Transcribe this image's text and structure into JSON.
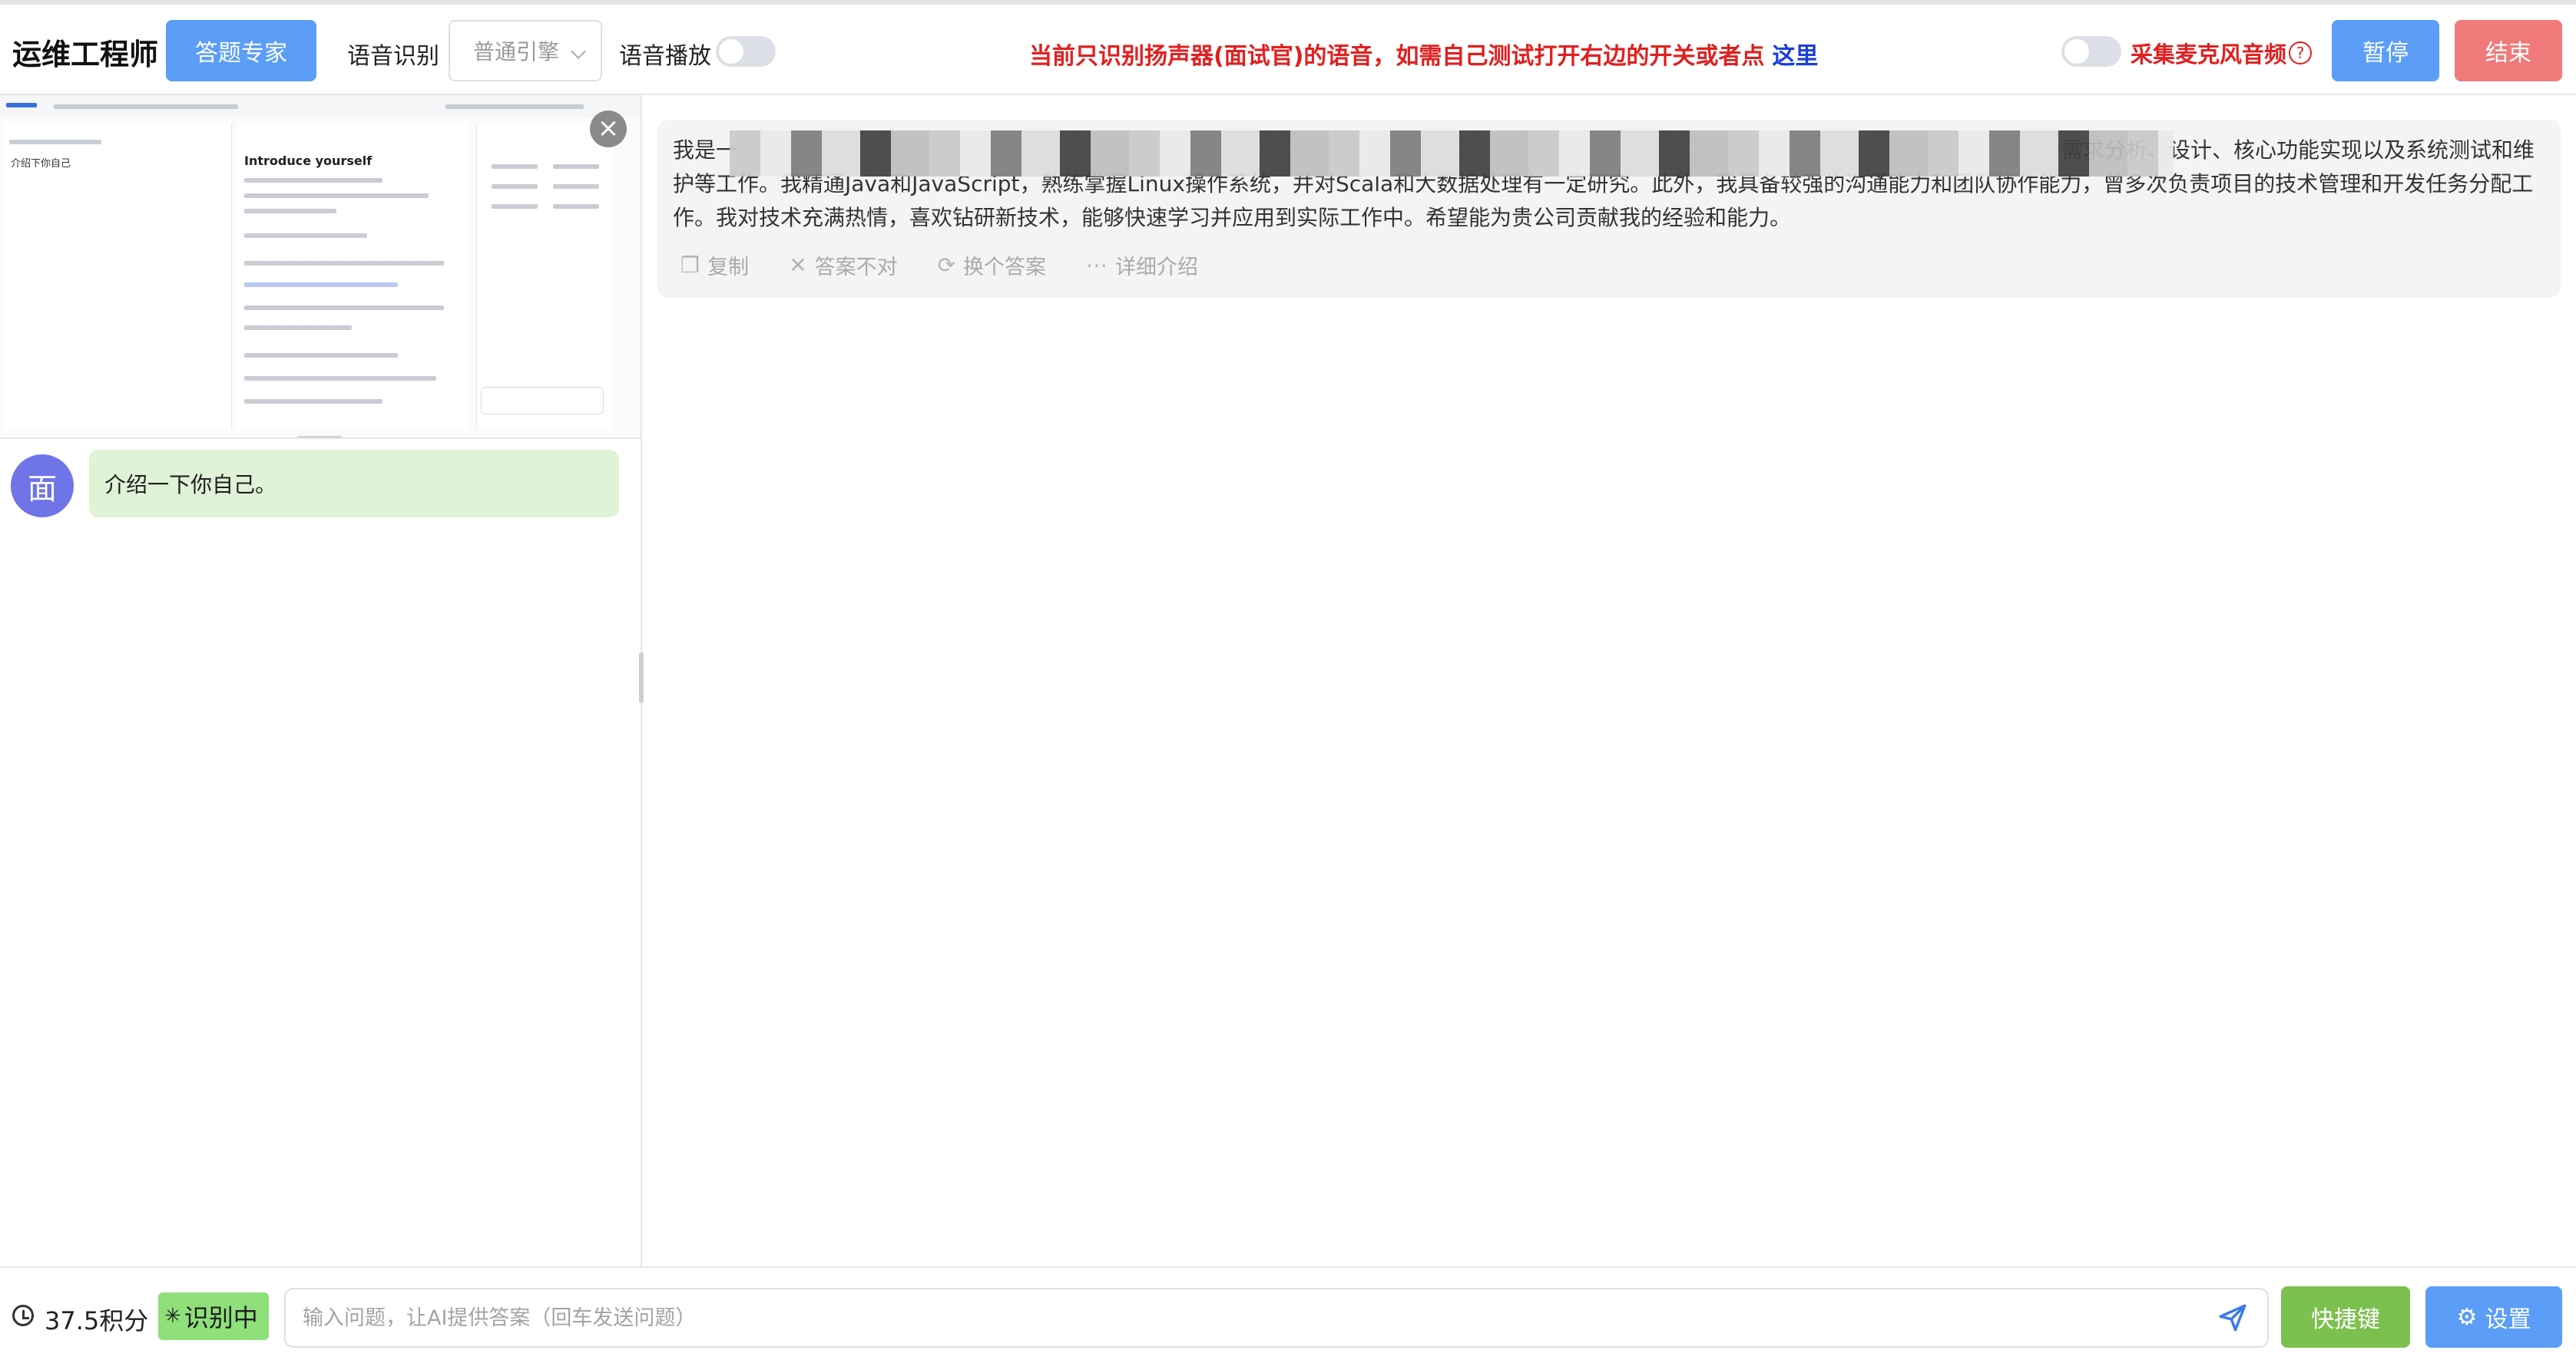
{
  "header": {
    "title": "运维工程师",
    "expert_button": "答题专家",
    "asr_label": "语音识别",
    "engine_value": "普通引擎",
    "tts_label": "语音播放",
    "notice": "当前只识别扬声器(面试官)的语音，如需自己测试打开右边的开关或者点",
    "notice_link": "这里",
    "mic_label": "采集麦克风音频",
    "help": "?",
    "pause_button": "暂停",
    "end_button": "结束"
  },
  "preview": {
    "left_title": "介绍下你自己",
    "page_heading": "Introduce yourself",
    "close": "×"
  },
  "chat": {
    "avatar": "面",
    "message": "介绍一下你自己。"
  },
  "answer": {
    "text_start": "我是一",
    "text_mid": "需求分析、设计、核心功能实现以及系统测试和维护等工作。我精通Java和JavaScript，熟练掌握Linux操作系统，并对Scala和大数据处理有一定研究。此外，我具备较强的沟通能力和团队协作能力，曾多次负责项目的技术管理和开发任务分配工作。我对技术充满热情，喜欢钻研新技术，能够快速学习并应用到实际工作中。希望能为贵公司贡献我的经验和能力。",
    "tools": {
      "copy": "复制",
      "wrong": "答案不对",
      "another": "换个答案",
      "detail": "详细介绍"
    }
  },
  "footer": {
    "points": "37.5积分",
    "recognizing": "识别中",
    "input_placeholder": "输入问题，让AI提供答案（回车发送问题）",
    "shortcut_button": "快捷键",
    "settings_button": "设置"
  }
}
